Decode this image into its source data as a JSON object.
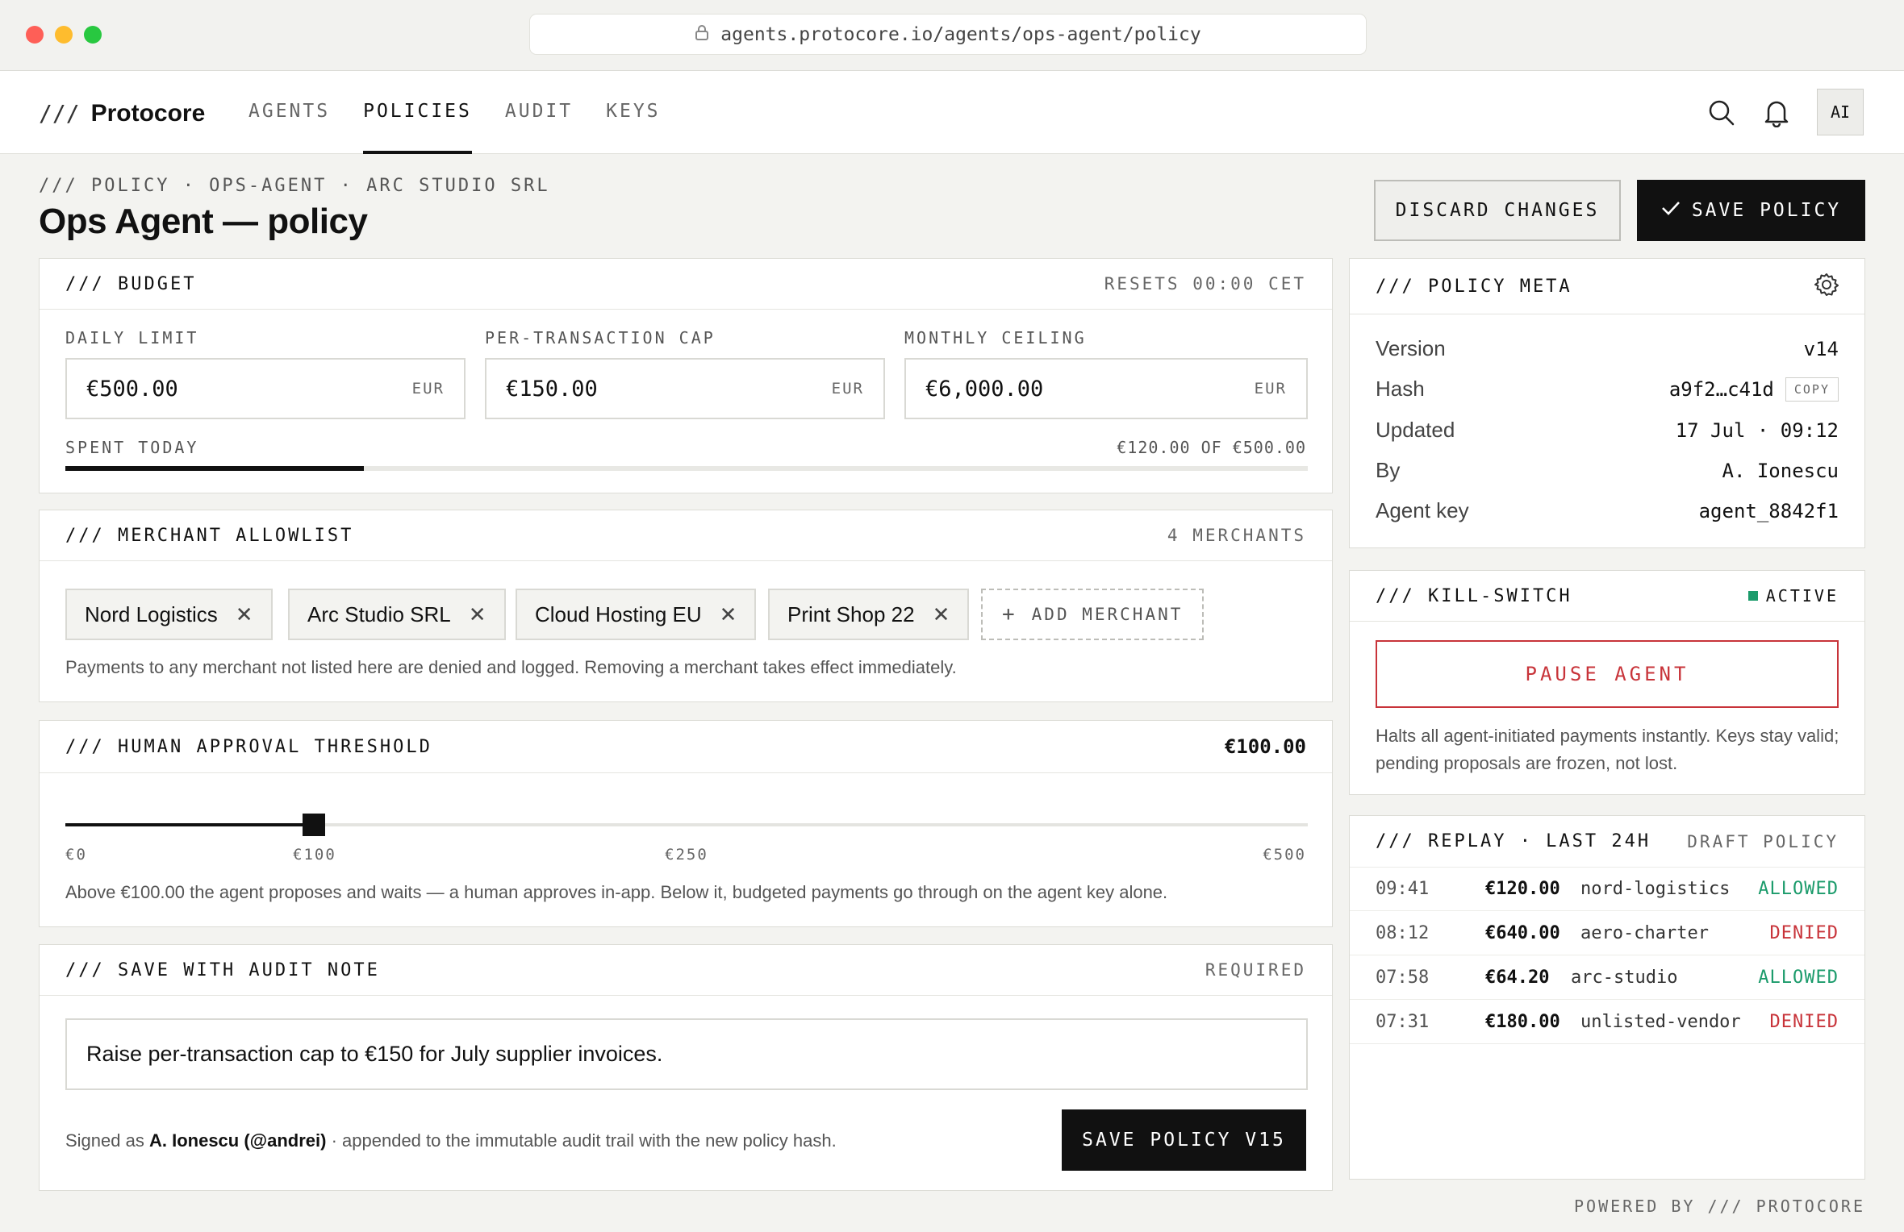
{
  "browser": {
    "url": "agents.protocore.io/agents/ops-agent/policy"
  },
  "header": {
    "brand_prefix": "///",
    "brand": "Protocore",
    "nav": [
      {
        "label": "AGENTS",
        "active": false
      },
      {
        "label": "POLICIES",
        "active": true
      },
      {
        "label": "AUDIT",
        "active": false
      },
      {
        "label": "KEYS",
        "active": false
      }
    ],
    "avatar": "AI"
  },
  "page": {
    "breadcrumb": "/// POLICY · OPS-AGENT · ARC STUDIO SRL",
    "title": "Ops Agent — policy",
    "discard_label": "DISCARD CHANGES",
    "save_label": "SAVE POLICY"
  },
  "budget": {
    "title": "/// BUDGET",
    "resets": "RESETS 00:00 CET",
    "fields": [
      {
        "label": "DAILY LIMIT",
        "value": "€500.00",
        "unit": "EUR"
      },
      {
        "label": "PER-TRANSACTION CAP",
        "value": "€150.00",
        "unit": "EUR"
      },
      {
        "label": "MONTHLY CEILING",
        "value": "€6,000.00",
        "unit": "EUR"
      }
    ],
    "spent_label": "SPENT TODAY",
    "spent_text": "€120.00 OF €500.00",
    "spent_fraction": 0.24
  },
  "allowlist": {
    "title": "/// MERCHANT ALLOWLIST",
    "count": "4 MERCHANTS",
    "merchants": [
      "Nord Logistics",
      "Arc Studio SRL",
      "Cloud Hosting EU",
      "Print Shop 22"
    ],
    "add_label": "ADD MERCHANT",
    "help": "Payments to any merchant not listed here are denied and logged. Removing a merchant takes effect immediately."
  },
  "threshold": {
    "title": "/// HUMAN APPROVAL THRESHOLD",
    "value_text": "€100.00",
    "value": 100,
    "max": 500,
    "ticks": [
      "€0",
      "€100",
      "€250",
      "€500"
    ],
    "help": "Above €100.00 the agent proposes and waits — a human approves in-app. Below it, budgeted payments go through on the agent key alone."
  },
  "audit": {
    "title": "/// SAVE WITH AUDIT NOTE",
    "required": "REQUIRED",
    "note": "Raise per-transaction cap to €150 for July supplier invoices.",
    "signed_prefix": "Signed as",
    "signed_name": "A. Ionescu (@andrei)",
    "signed_suffix": "· appended to the immutable audit trail with the new policy hash.",
    "save_label": "SAVE POLICY V15"
  },
  "meta": {
    "title": "/// POLICY META",
    "rows": [
      {
        "key": "Version",
        "value": "v14"
      },
      {
        "key": "Hash",
        "value": "a9f2…c41d",
        "copy": "COPY"
      },
      {
        "key": "Updated",
        "value": "17 Jul · 09:12"
      },
      {
        "key": "By",
        "value": "A. Ionescu"
      },
      {
        "key": "Agent key",
        "value": "agent_8842f1"
      }
    ]
  },
  "killswitch": {
    "title": "/// KILL-SWITCH",
    "status": "ACTIVE",
    "pause_label": "PAUSE AGENT",
    "help": "Halts all agent-initiated payments instantly. Keys stay valid; pending proposals are frozen, not lost."
  },
  "replay": {
    "title": "/// REPLAY · LAST 24H",
    "tag": "DRAFT POLICY",
    "rows": [
      {
        "time": "09:41",
        "amount": "€120.00",
        "merchant": "nord-logistics",
        "result": "ALLOWED"
      },
      {
        "time": "08:12",
        "amount": "€640.00",
        "merchant": "aero-charter",
        "result": "DENIED"
      },
      {
        "time": "07:58",
        "amount": "€64.20",
        "merchant": "arc-studio",
        "result": "ALLOWED"
      },
      {
        "time": "07:31",
        "amount": "€180.00",
        "merchant": "unlisted-vendor",
        "result": "DENIED"
      }
    ]
  },
  "footer": "POWERED BY /// PROTOCORE",
  "colors": {
    "accent": "#111111",
    "allowed": "#1b9b6b",
    "denied": "#c8343a",
    "active": "#1b9b6b"
  }
}
